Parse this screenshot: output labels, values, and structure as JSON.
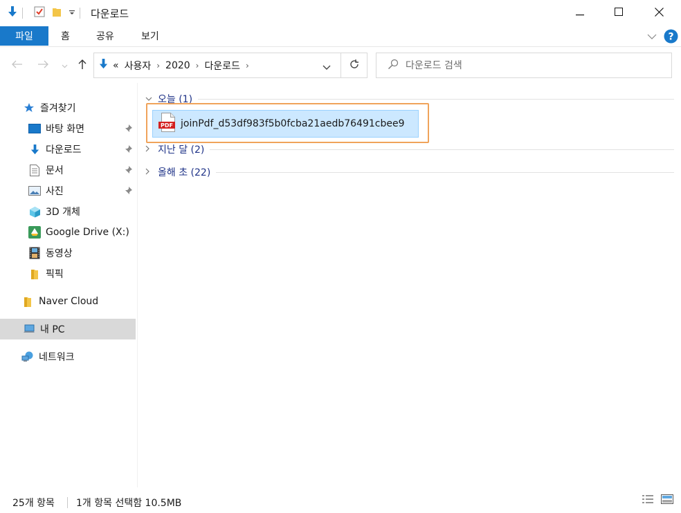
{
  "window": {
    "title": "다운로드",
    "controls": {
      "minimize": "minimize-icon",
      "maximize": "maximize-icon",
      "close": "close-icon"
    }
  },
  "ribbon": {
    "tabs": [
      {
        "label": "파일",
        "active": true
      },
      {
        "label": "홈"
      },
      {
        "label": "공유"
      },
      {
        "label": "보기"
      }
    ]
  },
  "address": {
    "prefix": "«",
    "crumbs": [
      "사용자",
      "2020",
      "다운로드"
    ]
  },
  "search": {
    "placeholder": "다운로드 검색"
  },
  "sidebar": {
    "quick_access": "즐겨찾기",
    "items": [
      {
        "label": "바탕 화면",
        "icon": "desktop-icon",
        "pinned": true
      },
      {
        "label": "다운로드",
        "icon": "download-arrow-icon",
        "pinned": true
      },
      {
        "label": "문서",
        "icon": "document-icon",
        "pinned": true
      },
      {
        "label": "사진",
        "icon": "pictures-icon",
        "pinned": true
      },
      {
        "label": "3D 개체",
        "icon": "3d-objects-icon"
      },
      {
        "label": "Google Drive (X:)",
        "icon": "google-drive-icon"
      },
      {
        "label": "동영상",
        "icon": "video-icon"
      },
      {
        "label": "픽픽",
        "icon": "folder-icon"
      }
    ],
    "naver": "Naver Cloud",
    "this_pc": "내 PC",
    "network": "네트워크"
  },
  "groups": [
    {
      "label": "오늘 (1)",
      "expanded": true
    },
    {
      "label": "지난 달 (2)",
      "expanded": false
    },
    {
      "label": "올해 초 (22)",
      "expanded": false
    }
  ],
  "files": [
    {
      "name": "joinPdf_d53df983f5b0fcba21aedb76491cbee9",
      "icon_text": "PDF"
    }
  ],
  "status": {
    "count": "25개 항목",
    "selection": "1개 항목 선택함 10.5MB"
  },
  "colors": {
    "accent": "#1979ca",
    "selection": "#cce8ff",
    "highlight": "#f0a35a",
    "group_text": "#1e3287"
  }
}
